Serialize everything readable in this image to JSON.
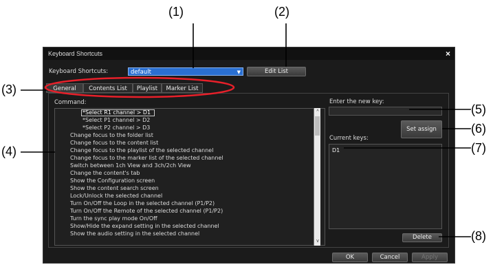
{
  "callouts": [
    "(1)",
    "(2)",
    "(3)",
    "(4)",
    "(5)",
    "(6)",
    "(7)",
    "(8)"
  ],
  "dialog": {
    "title": "Keyboard Shortcuts",
    "close_glyph": "×",
    "shortcuts_label": "Keyboard Shortcuts:",
    "shortcuts_value": "default",
    "edit_list": "Edit List",
    "tabs": [
      "General",
      "Contents List",
      "Playlist",
      "Marker List"
    ],
    "command_label": "Command:",
    "commands": [
      "*Select R1 channel > D1",
      "*Select P1 channel > D2",
      "*Select P2 channel > D3",
      "Change focus to the folder list",
      "Change focus to the content list",
      "Change focus to the playlist of the selected channel",
      "Change focus to the marker list of the selected channel",
      "Switch between 1ch View and 3ch/2ch View",
      "Change the content's tab",
      "Show the Configuration screen",
      "Show the content search screen",
      "Lock/Unlock the selected channel",
      "Turn On/Off the Loop  in the selected channel (P1/P2)",
      "Turn On/Off the Remote of the selected channel (P1/P2)",
      "Turn the sync play mode On/Off",
      "Show/Hide the expand setting in the selected channel",
      "Show the audio setting in the selected channel"
    ],
    "enter_new_key_label": "Enter the new key:",
    "set_assign": "Set assign",
    "current_keys_label": "Current keys:",
    "current_key": "D1",
    "delete": "Delete",
    "ok": "OK",
    "cancel": "Cancel",
    "apply": "Apply"
  },
  "colors": {
    "dialog_bg": "#1b1b1b",
    "dropdown": "#2a6fd1",
    "callout_circle": "#e8202a"
  }
}
